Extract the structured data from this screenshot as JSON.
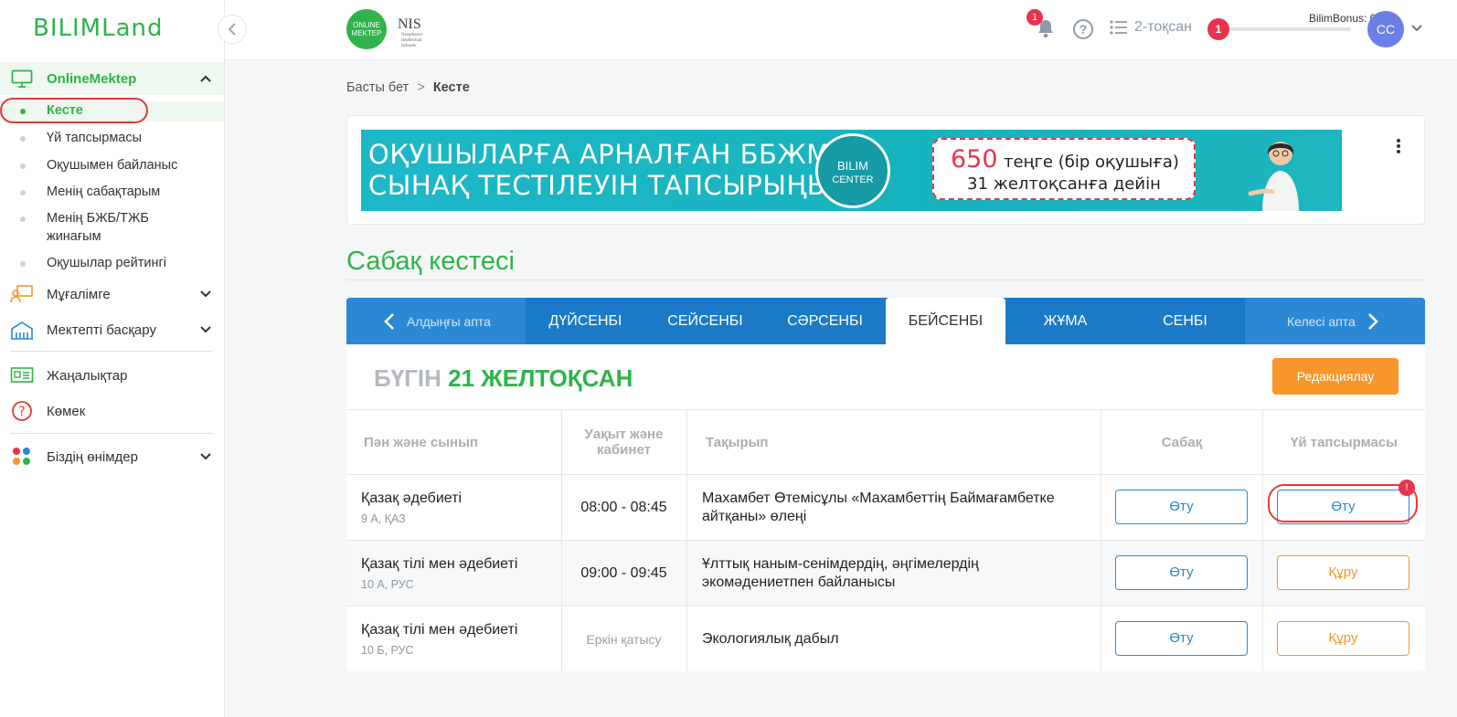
{
  "app": {
    "logo": "BILIMLand"
  },
  "sidebar": {
    "section": {
      "label": "OnlineMektep"
    },
    "subitems": [
      {
        "label": "Кесте"
      },
      {
        "label": "Үй тапсырмасы"
      },
      {
        "label": "Оқушымен байланыс"
      },
      {
        "label": "Менің сабақтарым"
      },
      {
        "label": "Менің БЖБ/ТЖБ жинағым"
      },
      {
        "label": "Оқушылар рейтингі"
      }
    ],
    "groups": [
      {
        "label": "Мұғалімге"
      },
      {
        "label": "Мектепті басқару"
      }
    ],
    "links": [
      {
        "label": "Жаңалықтар"
      },
      {
        "label": "Көмек"
      },
      {
        "label": "Біздің өнімдер"
      }
    ]
  },
  "header": {
    "online_logo": "ONLINE MEKTEP",
    "nis_logo": "NIS",
    "nis_sub": "Nazarbayev Intellectual Schools",
    "notification_count": "1",
    "quarter": "2-тоқсан",
    "bonus_label": "BilimBonus: 0",
    "bonus_level": "1",
    "avatar": "СС"
  },
  "breadcrumb": {
    "home": "Басты бет",
    "separator": ">",
    "current": "Кесте"
  },
  "banner": {
    "line1": "ОҚУШЫЛАРҒА АРНАЛҒАН ББЖМ",
    "line2": "СЫНАҚ ТЕСТІЛЕУІН ТАПСЫРЫҢЫЗ!",
    "brand1": "BILIM",
    "brand2": "CENTER",
    "price": "650",
    "price_unit": "теңге (бір оқушыға)",
    "deadline": "31 желтоқсанға дейін"
  },
  "page_title": "Сабақ кестесі",
  "week": {
    "prev": "Алдыңғы апта",
    "next": "Келесі апта",
    "days": [
      "ДҮЙСЕНБІ",
      "СЕЙСЕНБІ",
      "СӘРСЕНБІ",
      "БЕЙСЕНБІ",
      "ЖҰМА",
      "СЕНБІ"
    ],
    "active_day": "БЕЙСЕНБІ"
  },
  "today": {
    "prefix": "БҮГІН",
    "date": "21 ЖЕЛТОҚСАН"
  },
  "edit_button": "Редакциялау",
  "table": {
    "headers": [
      "Пән және сынып",
      "Уақыт және кабинет",
      "Тақырып",
      "Сабақ",
      "Үй тапсырмасы"
    ],
    "rows": [
      {
        "subject": "Қазақ әдебиеті",
        "class": "9 А, ҚАЗ",
        "time": "08:00 - 08:45",
        "topic": "Махамбет Өтемісұлы «Махамбеттің Баймағамбетке айтқаны» өлеңі",
        "lesson": "Өту",
        "homework": "Өту",
        "homework_badge": "!"
      },
      {
        "subject": "Қазақ тілі мен әдебиеті",
        "class": "10 А, РУС",
        "time": "09:00 - 09:45",
        "topic": "Ұлттық наным-сенімдердің, әңгімелердің экомәдениетпен байланысы",
        "lesson": "Өту",
        "homework": "Құру"
      },
      {
        "subject": "Қазақ тілі мен әдебиеті",
        "class": "10 Б, РУС",
        "time": "Еркін қатысу",
        "topic": "Экологиялық дабыл",
        "lesson": "Өту",
        "homework": "Құру"
      }
    ]
  },
  "colors": {
    "brand_green": "#2fb34a",
    "tab_blue": "#1a7ac7",
    "accent_orange": "#f7962a",
    "badge_red": "#e8344a"
  }
}
